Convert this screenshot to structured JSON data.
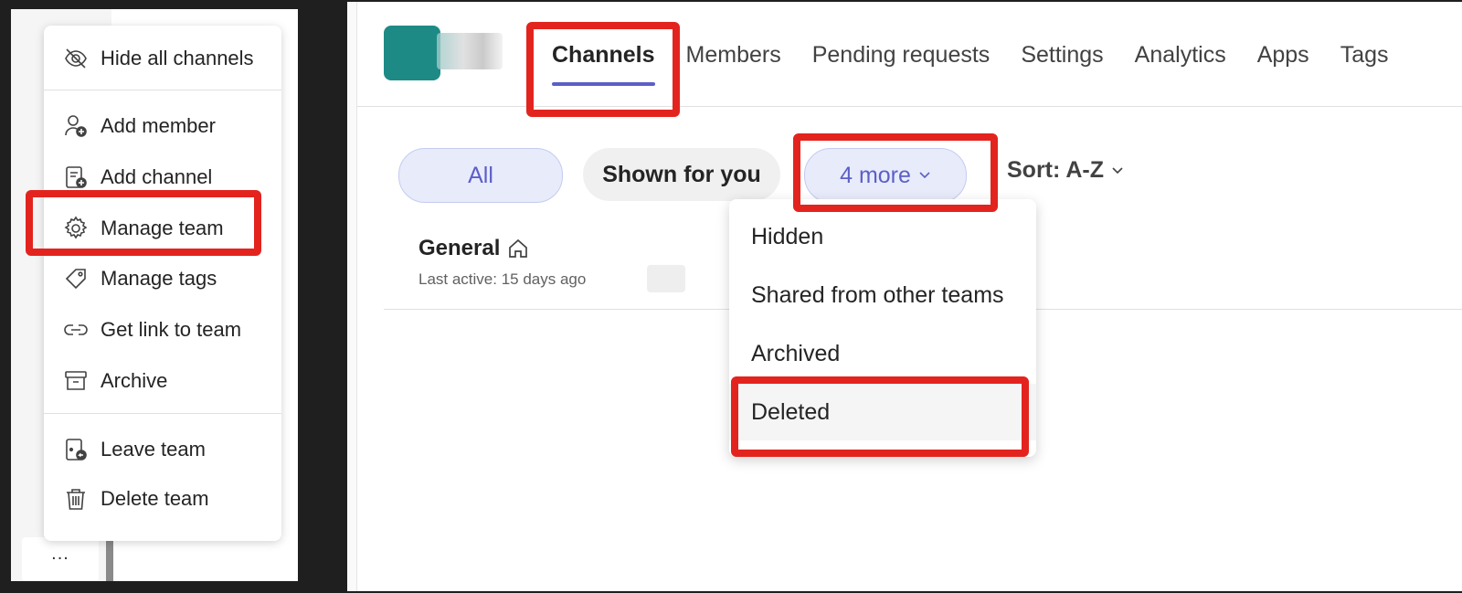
{
  "context_menu": {
    "items": [
      {
        "label": "Hide all channels",
        "icon": "eye-off-icon"
      },
      {
        "label": "Add member",
        "icon": "person-add-icon"
      },
      {
        "label": "Add channel",
        "icon": "channel-add-icon"
      },
      {
        "label": "Manage team",
        "icon": "gear-icon"
      },
      {
        "label": "Manage tags",
        "icon": "tag-icon"
      },
      {
        "label": "Get link to team",
        "icon": "link-icon"
      },
      {
        "label": "Archive",
        "icon": "archive-icon"
      },
      {
        "label": "Leave team",
        "icon": "leave-icon"
      },
      {
        "label": "Delete team",
        "icon": "trash-icon"
      }
    ]
  },
  "more_button_label": "...",
  "tabs": [
    {
      "label": "Channels",
      "active": true
    },
    {
      "label": "Members"
    },
    {
      "label": "Pending requests"
    },
    {
      "label": "Settings"
    },
    {
      "label": "Analytics"
    },
    {
      "label": "Apps"
    },
    {
      "label": "Tags"
    }
  ],
  "filters": {
    "all": "All",
    "shown_for_you": "Shown for you",
    "more": "4 more",
    "sort": "Sort: A-Z"
  },
  "channel": {
    "name": "General",
    "last_active": "Last active: 15 days ago"
  },
  "dropdown": {
    "items": [
      "Hidden",
      "Shared from other teams",
      "Archived",
      "Deleted"
    ]
  },
  "colors": {
    "accent": "#5b5fc7",
    "highlight": "#e3241e",
    "team_avatar": "#1e8a86"
  }
}
